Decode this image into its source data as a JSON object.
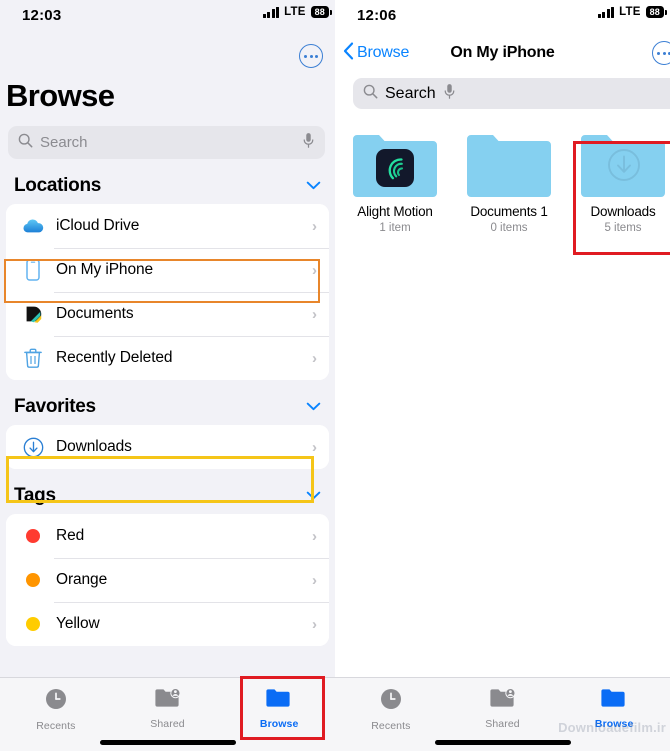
{
  "left": {
    "status": {
      "time": "12:03",
      "network": "LTE",
      "battery": "88"
    },
    "more_button": "more-options",
    "page_title": "Browse",
    "search": {
      "placeholder": "Search"
    },
    "sections": [
      {
        "title": "Locations",
        "rows": [
          {
            "label": "iCloud Drive",
            "icon": "icloud-icon"
          },
          {
            "label": "On My iPhone",
            "icon": "iphone-icon"
          },
          {
            "label": "Documents",
            "icon": "documents-app-icon"
          },
          {
            "label": "Recently Deleted",
            "icon": "trash-icon"
          }
        ]
      },
      {
        "title": "Favorites",
        "rows": [
          {
            "label": "Downloads",
            "icon": "download-circle-icon"
          }
        ]
      },
      {
        "title": "Tags",
        "rows": [
          {
            "label": "Red",
            "icon": "tag-dot-icon",
            "color": "#FF3B30"
          },
          {
            "label": "Orange",
            "icon": "tag-dot-icon",
            "color": "#FF9500"
          },
          {
            "label": "Yellow",
            "icon": "tag-dot-icon",
            "color": "#FFCC00"
          }
        ]
      }
    ],
    "tabs": [
      {
        "label": "Recents",
        "icon": "clock-icon",
        "active": false
      },
      {
        "label": "Shared",
        "icon": "shared-folder-icon",
        "active": false
      },
      {
        "label": "Browse",
        "icon": "folder-icon",
        "active": true
      }
    ]
  },
  "right": {
    "status": {
      "time": "12:06",
      "network": "LTE",
      "battery": "88"
    },
    "back_label": "Browse",
    "title": "On My iPhone",
    "search": {
      "placeholder": "Search"
    },
    "folders": [
      {
        "name": "Alight Motion",
        "count": "1 item",
        "badge": "alight-motion-app-icon"
      },
      {
        "name": "Documents 1",
        "count": "0 items",
        "badge": "none"
      },
      {
        "name": "Downloads",
        "count": "5 items",
        "badge": "download-arrow-icon"
      }
    ],
    "tabs": [
      {
        "label": "Recents",
        "icon": "clock-icon",
        "active": false
      },
      {
        "label": "Shared",
        "icon": "shared-folder-icon",
        "active": false
      },
      {
        "label": "Browse",
        "icon": "folder-icon",
        "active": true
      }
    ]
  },
  "annotations": {
    "orange_box": "highlight-on-my-iphone",
    "yellow_box": "highlight-downloads-favorite",
    "red_box_tab": "highlight-browse-tab",
    "red_box_folder": "highlight-downloads-folder"
  },
  "watermark": "Downloadefilm.ir",
  "colors": {
    "accent": "#0A84FF",
    "orange_highlight": "#E8862B",
    "yellow_highlight": "#F5C518",
    "red_highlight": "#E01B22",
    "folder_blue": "#85D0F0"
  }
}
